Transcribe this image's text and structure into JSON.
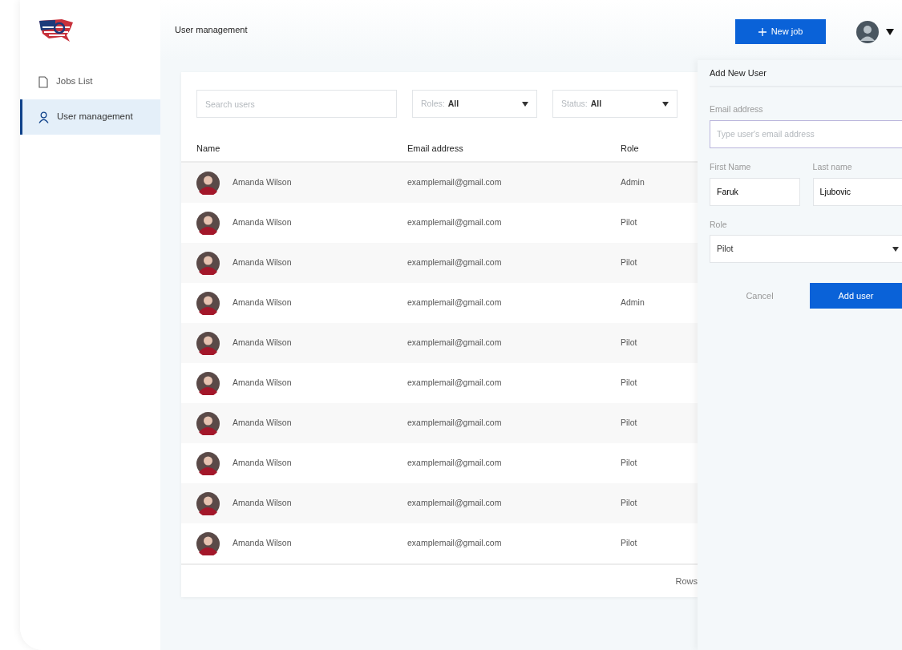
{
  "sidebar": {
    "items": [
      {
        "label": "Jobs List",
        "kind": "document",
        "selected": false
      },
      {
        "label": "User management",
        "kind": "user",
        "selected": true
      }
    ]
  },
  "header": {
    "breadcrumb": "User management",
    "new_job_button": "New job"
  },
  "filters": {
    "search_placeholder": "Search users",
    "roles": {
      "label": "Roles:",
      "value": "All"
    },
    "status": {
      "label": "Status:",
      "value": "All"
    }
  },
  "table": {
    "columns": [
      "Name",
      "Email address",
      "Role"
    ],
    "rows": [
      {
        "name": "Amanda Wilson",
        "email": "examplemail@gmail.com",
        "role": "Admin"
      },
      {
        "name": "Amanda Wilson",
        "email": "examplemail@gmail.com",
        "role": "Pilot"
      },
      {
        "name": "Amanda Wilson",
        "email": "examplemail@gmail.com",
        "role": "Pilot"
      },
      {
        "name": "Amanda Wilson",
        "email": "examplemail@gmail.com",
        "role": "Admin"
      },
      {
        "name": "Amanda Wilson",
        "email": "examplemail@gmail.com",
        "role": "Pilot"
      },
      {
        "name": "Amanda Wilson",
        "email": "examplemail@gmail.com",
        "role": "Pilot"
      },
      {
        "name": "Amanda Wilson",
        "email": "examplemail@gmail.com",
        "role": "Pilot"
      },
      {
        "name": "Amanda Wilson",
        "email": "examplemail@gmail.com",
        "role": "Pilot"
      },
      {
        "name": "Amanda Wilson",
        "email": "examplemail@gmail.com",
        "role": "Pilot"
      },
      {
        "name": "Amanda Wilson",
        "email": "examplemail@gmail.com",
        "role": "Pilot"
      }
    ],
    "footer": "Rows"
  },
  "panel": {
    "title": "Add New User",
    "email": {
      "label": "Email address",
      "placeholder": "Type user's email address"
    },
    "first_name": {
      "label": "First Name",
      "value": "Faruk"
    },
    "last_name": {
      "label": "Last name",
      "value": "Ljubovic"
    },
    "role": {
      "label": "Role",
      "value": "Pilot"
    },
    "cancel_button": "Cancel",
    "add_button": "Add user"
  }
}
